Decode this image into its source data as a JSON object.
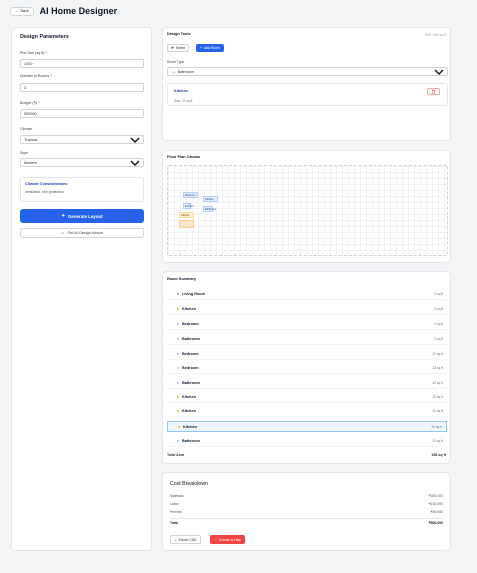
{
  "header": {
    "back_label": "Back",
    "title": "AI Home Designer"
  },
  "params": {
    "title": "Design Parameters",
    "plot_size_label": "Plot Size (sq ft) *",
    "plot_size_value": "1000",
    "rooms_label": "Number of Rooms *",
    "rooms_value": "3",
    "budget_label": "Budget (₹) *",
    "budget_value": "500000",
    "climate_label": "Climate",
    "climate_value": "Tropical",
    "style_label": "Style",
    "style_value": "Modern",
    "climate_box_title": "Climate Considerations",
    "climate_box_text": "ventilation, rain protection",
    "generate_label": "Generate Layout",
    "advice_label": "Get AI Design Advice"
  },
  "tools": {
    "title": "Design Tools",
    "plot_info": "Plot: 1000 sq ft",
    "select_label": "Select",
    "add_room_label": "Add Room",
    "room_type_label": "Room Type",
    "room_type_value": "Bathroom",
    "selected_room_name": "Kitchen",
    "selected_room_size": "Size: 22 sq ft"
  },
  "canvas": {
    "title": "Floor Plan Canvas",
    "rooms": [
      "Bedroom",
      "Kitchen",
      "Kitchen",
      "Bathroom",
      "Kitchen"
    ]
  },
  "summary": {
    "title": "Room Summary",
    "rows": [
      {
        "name": "Living Room",
        "area": "0 sq ft",
        "dot": "#9ca3af"
      },
      {
        "name": "Kitchen",
        "area": "0 sq ft",
        "dot": "#fbbf24"
      },
      {
        "name": "Bedroom",
        "area": "0 sq ft",
        "dot": "#c4b5fd"
      },
      {
        "name": "Bathroom",
        "area": "0 sq ft",
        "dot": "#93c5fd"
      },
      {
        "name": "Bedroom",
        "area": "22 sq ft",
        "dot": "#c4b5fd"
      },
      {
        "name": "Bedroom",
        "area": "22 sq ft",
        "dot": "#c4b5fd"
      },
      {
        "name": "Bathroom",
        "area": "22 sq ft",
        "dot": "#93c5fd"
      },
      {
        "name": "Kitchen",
        "area": "22 sq ft",
        "dot": "#fbbf24"
      },
      {
        "name": "Kitchen",
        "area": "22 sq ft",
        "dot": "#fbbf24"
      },
      {
        "name": "Kitchen",
        "area": "22 sq ft",
        "dot": "#fbbf24"
      },
      {
        "name": "Bathroom",
        "area": "22 sq ft",
        "dot": "#93c5fd"
      }
    ],
    "total_label": "Total Area",
    "total_value": "158 sq ft"
  },
  "cost": {
    "title": "Cost Breakdown",
    "materials_label": "Materials",
    "materials_value": "₹300,000",
    "labor_label": "Labor",
    "labor_value": "₹150,000",
    "permits_label": "Permits",
    "permits_value": "₹50,000",
    "total_label": "Total",
    "total_value": "₹500,000",
    "export_label": "Export CAD",
    "donate_label": "Donate & Help"
  },
  "colors": {
    "accent": "#2563eb",
    "danger": "#ef4444"
  }
}
